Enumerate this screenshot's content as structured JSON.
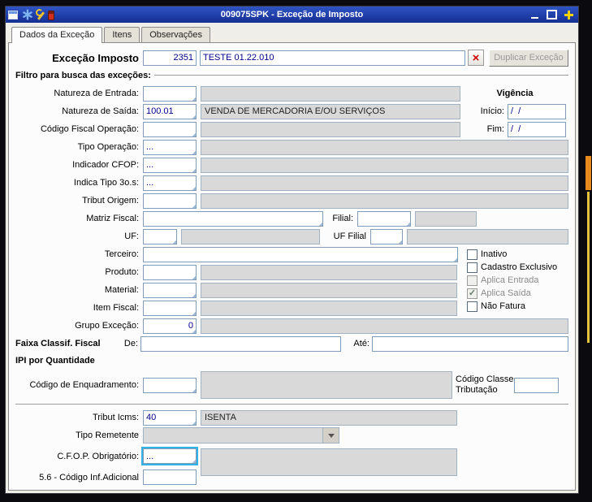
{
  "window": {
    "title": "009075SPK - Exceção de Imposto"
  },
  "tabs": [
    {
      "label": "Dados da Exceção"
    },
    {
      "label": "Itens"
    },
    {
      "label": "Observações"
    }
  ],
  "header": {
    "label": "Exceção Imposto",
    "code": "2351",
    "description": "TESTE 01.22.010",
    "duplicate_button": "Duplicar Exceção"
  },
  "sections": {
    "filter_title": "Filtro para busca das exceções:",
    "faixa_title": "Faixa Classif. Fiscal",
    "ipi_title": "IPI por Quantidade"
  },
  "vigencia": {
    "title": "Vigência",
    "inicio_label": "Início:",
    "inicio_value": "/  /",
    "fim_label": "Fim:",
    "fim_value": "/  /"
  },
  "fields": {
    "natureza_entrada": {
      "label": "Natureza de Entrada:",
      "value": "",
      "display": ""
    },
    "natureza_saida": {
      "label": "Natureza de Saída:",
      "value": "100.01",
      "display": "VENDA DE MERCADORIA E/OU SERVIÇOS"
    },
    "codigo_fiscal_operacao": {
      "label": "Código Fiscal Operação:",
      "value": "",
      "display": ""
    },
    "tipo_operacao": {
      "label": "Tipo Operação:",
      "value": "...",
      "display": ""
    },
    "indicador_cfop": {
      "label": "Indicador CFOP:",
      "value": "...",
      "display": ""
    },
    "indica_tipo_3os": {
      "label": "Indica Tipo 3o.s:",
      "value": "...",
      "display": ""
    },
    "tribut_origem": {
      "label": "Tribut Origem:",
      "value": "",
      "display": ""
    },
    "matriz_fiscal": {
      "label": "Matriz Fiscal:",
      "value": ""
    },
    "filial": {
      "label": "Filial:",
      "value": "",
      "display": ""
    },
    "uf": {
      "label": "UF:",
      "value": "",
      "display": ""
    },
    "uf_filial": {
      "label": "UF Filial",
      "value": "",
      "display": ""
    },
    "terceiro": {
      "label": "Terceiro:",
      "value": ""
    },
    "produto": {
      "label": "Produto:",
      "value": "",
      "display": ""
    },
    "material": {
      "label": "Material:",
      "value": "",
      "display": ""
    },
    "item_fiscal": {
      "label": "Item Fiscal:",
      "value": "",
      "display": ""
    },
    "grupo_excecao": {
      "label": "Grupo Exceção:",
      "value": "0",
      "display": ""
    },
    "faixa_de": {
      "label": "De:",
      "value": ""
    },
    "faixa_ate": {
      "label": "Até:",
      "value": ""
    },
    "cod_enquadramento": {
      "label": "Código de Enquadramento:",
      "value": "",
      "display": ""
    },
    "cod_classe": {
      "label": "Código Classe Tributação",
      "value": ""
    },
    "tribut_icms": {
      "label": "Tribut Icms:",
      "value": "40",
      "display": "ISENTA"
    },
    "tipo_remetente": {
      "label": "Tipo Remetente",
      "value": ""
    },
    "cfop_obrigatorio": {
      "label": "C.F.O.P. Obrigatório:",
      "value": "...",
      "display": ""
    },
    "cod_inf_adicional": {
      "label": "5.6 - Código Inf.Adicional",
      "value": ""
    }
  },
  "checkboxes": [
    {
      "label": "Inativo",
      "mark": ""
    },
    {
      "label": "Cadastro Exclusivo",
      "mark": ""
    },
    {
      "label": "Aplica Entrada",
      "mark": ""
    },
    {
      "label": "Aplica Saída",
      "mark": "✓"
    },
    {
      "label": "Não Fatura",
      "mark": ""
    }
  ]
}
